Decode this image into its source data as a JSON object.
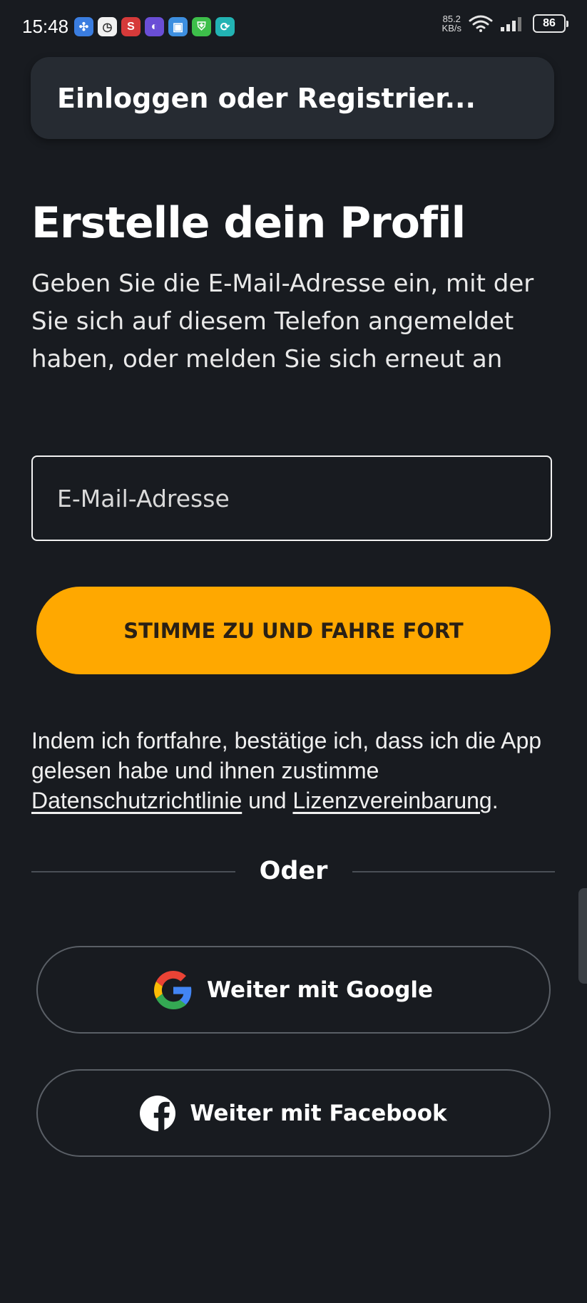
{
  "status_bar": {
    "time": "15:48",
    "speed_value": "85.2",
    "speed_unit": "KB/s",
    "battery": "86",
    "app_icons": [
      "pinwheel-app-icon",
      "clock-app-icon",
      "s-app-icon",
      "moon-app-icon",
      "calendar-app-icon",
      "shield-app-icon",
      "sync-app-icon"
    ]
  },
  "header": {
    "title": "Einloggen oder Registrier..."
  },
  "main": {
    "headline": "Erstelle dein Profil",
    "description": "Geben Sie die E-Mail-Adresse ein, mit der Sie sich auf diesem Telefon angemeldet haben, oder melden Sie sich erneut an",
    "email_placeholder": "E-Mail-Adresse",
    "email_value": "",
    "continue_label": "STIMME ZU UND FAHRE FORT"
  },
  "consent": {
    "text": "Indem ich fortfahre, bestätige ich, dass ich die App gelesen habe und ihnen zustimme",
    "privacy_link": "Datenschutzrichtlinie",
    "and": "und",
    "license_link": "Lizenzvereinbarung",
    "end": "."
  },
  "divider": {
    "label": "Oder"
  },
  "social": {
    "google_label": "Weiter mit Google",
    "facebook_label": "Weiter mit Facebook"
  },
  "colors": {
    "background": "#181b20",
    "accent": "#ffa800",
    "header_bg": "#262b32"
  }
}
